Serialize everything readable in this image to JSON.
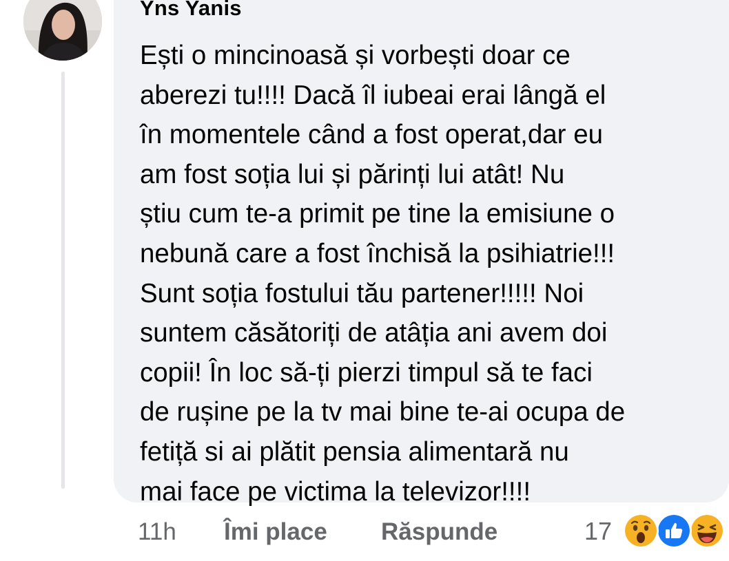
{
  "comment": {
    "author": "Yns Yanis",
    "avatar_icon": "profile-photo",
    "text_lines": [
      "Ești o mincinoasă și vorbești doar ce",
      "aberezi tu!!!! Dacă îl iubeai erai lângă el",
      "în momentele când a fost operat,dar eu",
      "am fost soția lui și părinți lui atât! Nu",
      "știu cum te-a primit pe tine la emisiune o",
      "nebună care a fost închisă la psihiatrie!!!",
      "Sunt soția fostului tău partener!!!!! Noi",
      "suntem căsătoriți de atâția ani avem doi",
      "copii! În loc să-ți pierzi timpul să te faci",
      "de rușine pe la tv mai bine te-ai ocupa de",
      "fetiță si ai plătit pensia alimentară nu",
      "mai face pe victima la televizor!!!!"
    ]
  },
  "actions": {
    "timestamp": "11h",
    "like_label": "Îmi place",
    "reply_label": "Răspunde"
  },
  "reactions": {
    "count": "17",
    "icons": [
      "wow-reaction-icon",
      "like-reaction-icon",
      "haha-reaction-icon"
    ]
  },
  "colors": {
    "bubble_background": "#f0f2f5",
    "text_primary": "#050505",
    "text_secondary": "#65676b",
    "like_blue": "#1877f2",
    "reaction_yellow": "#f7b125"
  }
}
